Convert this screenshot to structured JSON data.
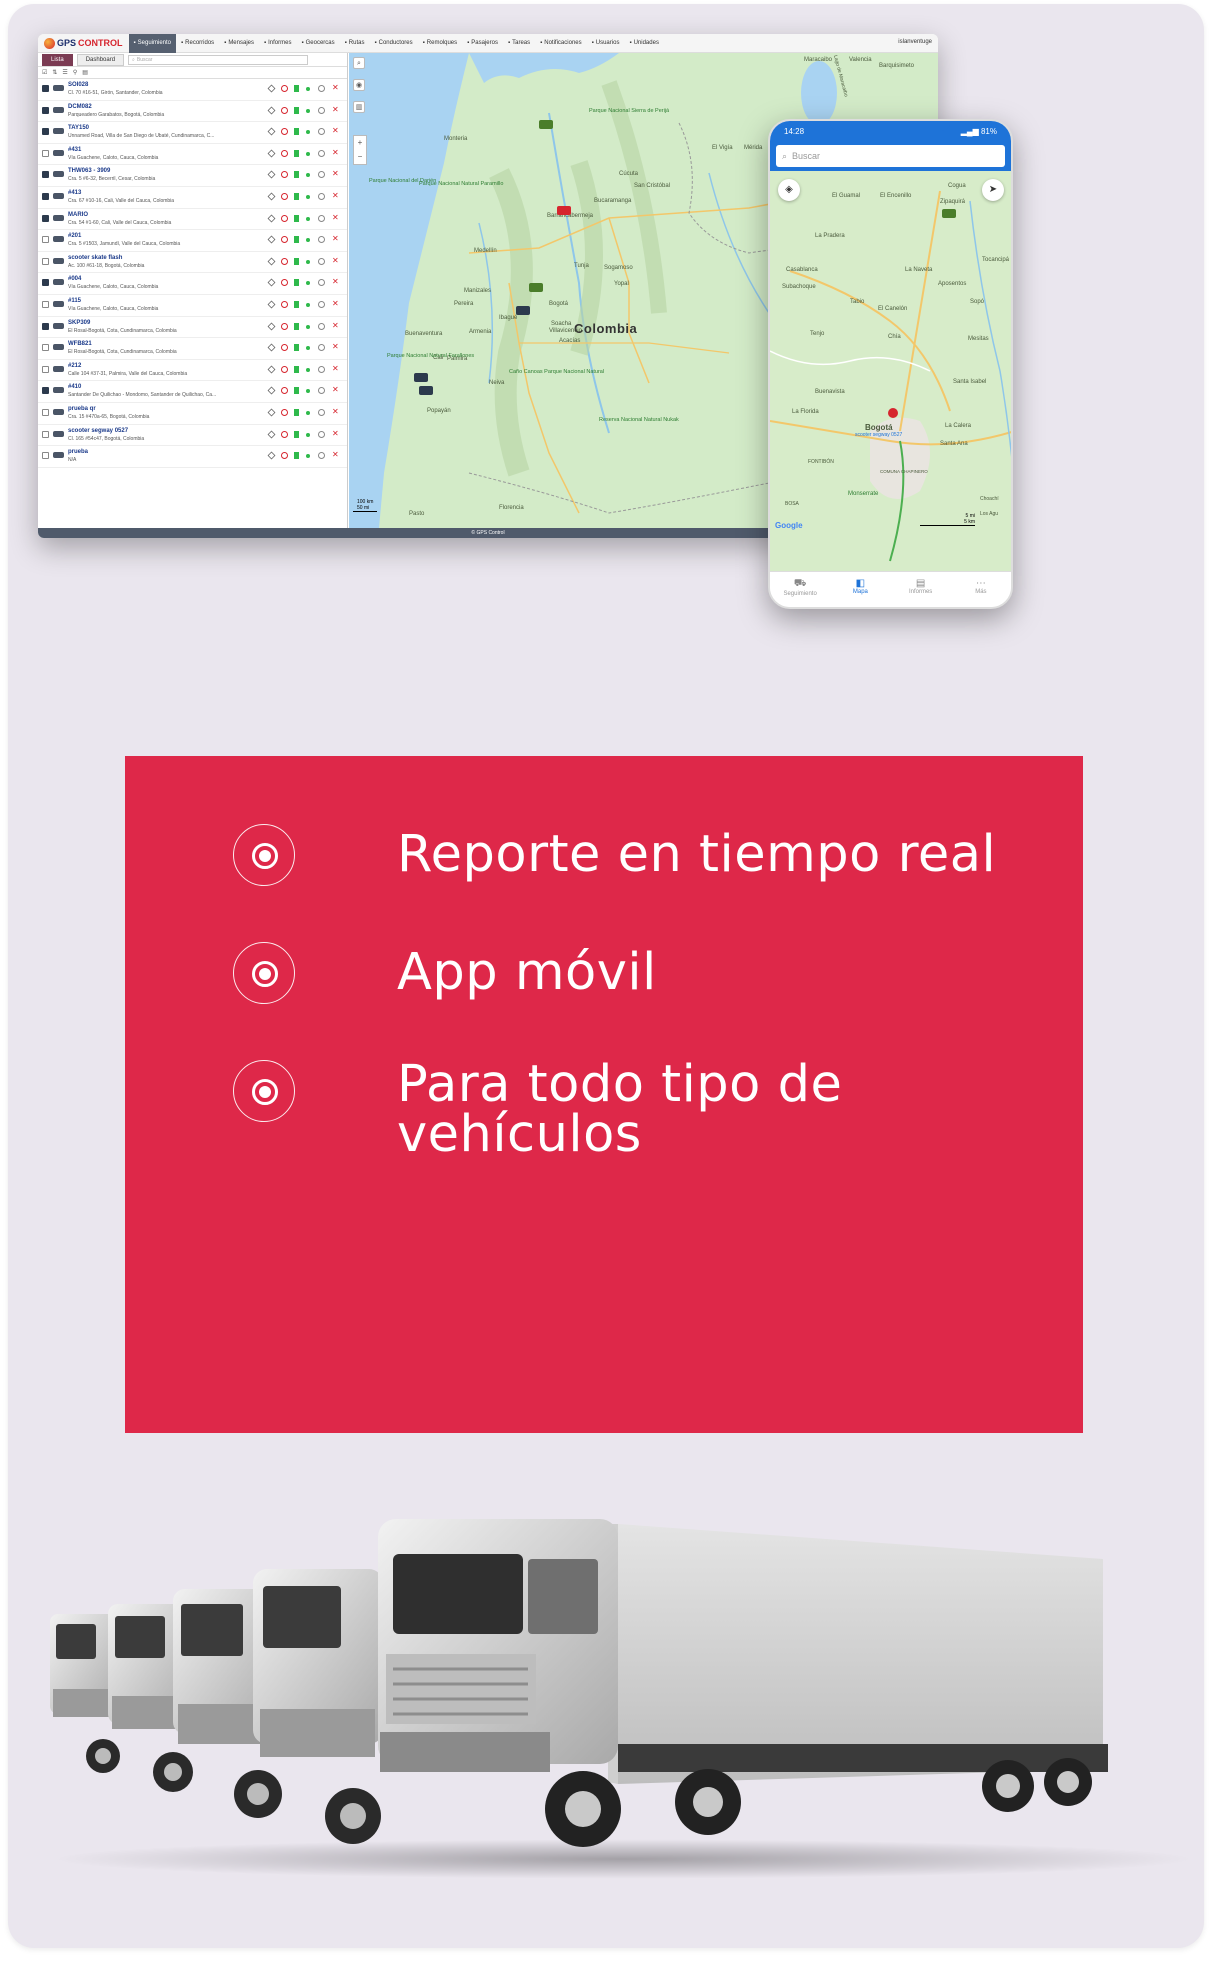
{
  "desktop": {
    "logo_text_1": "GPS",
    "logo_text_2": "CONTROL",
    "nav": [
      {
        "label": "Seguimiento",
        "icon": "tracking-icon",
        "active": true
      },
      {
        "label": "Recorridos",
        "icon": "flag-icon"
      },
      {
        "label": "Mensajes",
        "icon": "message-icon"
      },
      {
        "label": "Informes",
        "icon": "report-icon"
      },
      {
        "label": "Geocercas",
        "icon": "geofence-icon"
      },
      {
        "label": "Rutas",
        "icon": "route-icon"
      },
      {
        "label": "Conductores",
        "icon": "driver-icon"
      },
      {
        "label": "Remolques",
        "icon": "trailer-icon"
      },
      {
        "label": "Pasajeros",
        "icon": "passenger-icon"
      },
      {
        "label": "Tareas",
        "icon": "task-icon"
      },
      {
        "label": "Notificaciones",
        "icon": "bell-icon"
      },
      {
        "label": "Usuarios",
        "icon": "users-icon"
      },
      {
        "label": "Unidades",
        "icon": "car-icon"
      }
    ],
    "user": "islanventuge",
    "tabs": {
      "list": "Lista",
      "dashboard": "Dashboard"
    },
    "search_placeholder": "Buscar",
    "units": [
      {
        "name": "SOI028",
        "address": "Cl. 70 #16-51, Girón, Santander, Colombia",
        "checked": true
      },
      {
        "name": "DCM082",
        "address": "Parqueadero Garabatos, Bogotá, Colombia",
        "checked": true
      },
      {
        "name": "TAY150",
        "address": "Unnamed Road, Villa de San Diego de Ubaté, Cundinamarca, C...",
        "checked": true
      },
      {
        "name": "#431",
        "address": "Vía Guachene, Caloto, Cauca, Colombia",
        "checked": false
      },
      {
        "name": "THW063 - 3909",
        "address": "Cra. 5 #6-32, Becerril, Cesar, Colombia",
        "checked": true
      },
      {
        "name": "#413",
        "address": "Cra. 67 #10-16, Cali, Valle del Cauca, Colombia",
        "checked": true
      },
      {
        "name": "MARIO",
        "address": "Cra. 54 #1-60, Cali, Valle del Cauca, Colombia",
        "checked": true
      },
      {
        "name": "#201",
        "address": "Cra. 5 #1503, Jamundí, Valle del Cauca, Colombia",
        "checked": false
      },
      {
        "name": "scooter skate flash",
        "address": "Ac. 100 #61-18, Bogotá, Colombia",
        "checked": false
      },
      {
        "name": "#004",
        "address": "Vía Guachene, Caloto, Cauca, Colombia",
        "checked": true
      },
      {
        "name": "#115",
        "address": "Vía Guachene, Caloto, Cauca, Colombia",
        "checked": false
      },
      {
        "name": "SKP309",
        "address": "El Rosal-Bogotá, Cota, Cundinamarca, Colombia",
        "checked": true
      },
      {
        "name": "WFB821",
        "address": "El Rosal-Bogotá, Cota, Cundinamarca, Colombia",
        "checked": false
      },
      {
        "name": "#212",
        "address": "Calle 104 #37-31, Palmira, Valle del Cauca, Colombia",
        "checked": false
      },
      {
        "name": "#410",
        "address": "Santander De Quilichao - Mondomo, Santander de Quilichao, Ca...",
        "checked": true
      },
      {
        "name": "prueba qr",
        "address": "Cra. 15 #470a-65, Bogotá, Colombia",
        "checked": false
      },
      {
        "name": "scooter segway 0527",
        "address": "Cl. 165 #54c47, Bogotá, Colombia",
        "checked": false
      },
      {
        "name": "prueba",
        "address": "N/A",
        "checked": false
      }
    ],
    "map_labels": {
      "country": "Colombia",
      "cities": [
        "Medellín",
        "Bucaramanga",
        "Barrancabermeja",
        "Cúcuta",
        "San Cristóbal",
        "Monteria",
        "Manizales",
        "Pereira",
        "Ibagué",
        "Cali",
        "Palmira",
        "Bogotá",
        "Villavicencio",
        "Tunja",
        "Neiva",
        "Popayán",
        "Pasto",
        "Valencia",
        "Barquisimeto",
        "Maracaibo",
        "Mérida",
        "Armenia",
        "Buenaventura",
        "Yopal",
        "El Vigía",
        "Acacías",
        "Soacha",
        "Florencia",
        "Sogamoso"
      ],
      "parks": [
        "Parque Nacional Sierra de Perijá",
        "Parque Nacional del Darién",
        "Parque Nacional Natural Paramillo",
        "Parque Nacional Natural Farallones",
        "Caño Canoas Parque Nacional Natural",
        "Reserva Nacional Natural Nukak"
      ],
      "lake": "Lago de Maracaibo"
    },
    "scale": [
      "100 km",
      "50 mi"
    ],
    "footer": "© GPS Control"
  },
  "phone": {
    "time": "14:28",
    "battery": "81%",
    "search_placeholder": "Buscar",
    "map_labels": [
      "Cogua",
      "Zipaquirá",
      "El Guamal",
      "El Encenillo",
      "La Pradera",
      "Casablanca",
      "Subachoque",
      "Tabio",
      "La Naveta",
      "Aposentos",
      "Sopó",
      "Tocancipá",
      "El Canelón",
      "Tenjo",
      "Chía",
      "Mesitas",
      "Santa Isabel",
      "Buenavista",
      "La Calera",
      "La Florida",
      "Bogotá",
      "Santa Ana",
      "FONTIBÓN",
      "COMUNA CHAPINERO",
      "BOSA",
      "Monserrate",
      "Choachí",
      "Los Agu",
      "scooter segway 0527"
    ],
    "scale": [
      "5 mi",
      "5 km"
    ],
    "tabs": [
      {
        "label": "Seguimiento",
        "icon": "tracking-tab-icon"
      },
      {
        "label": "Mapa",
        "icon": "map-tab-icon",
        "active": true
      },
      {
        "label": "Informes",
        "icon": "reports-tab-icon"
      },
      {
        "label": "Más",
        "icon": "more-tab-icon"
      }
    ],
    "google": "Google"
  },
  "features": [
    {
      "icon": "target-icon",
      "text": "Reporte en tiempo real"
    },
    {
      "icon": "target-icon",
      "text": "App móvil"
    },
    {
      "icon": "target-icon",
      "text": "Para todo tipo de vehículos"
    }
  ],
  "colors": {
    "panel_red": "#de2849",
    "card_bg": "#eae6ee",
    "phone_blue": "#1e73d8",
    "active_nav": "#566070"
  }
}
